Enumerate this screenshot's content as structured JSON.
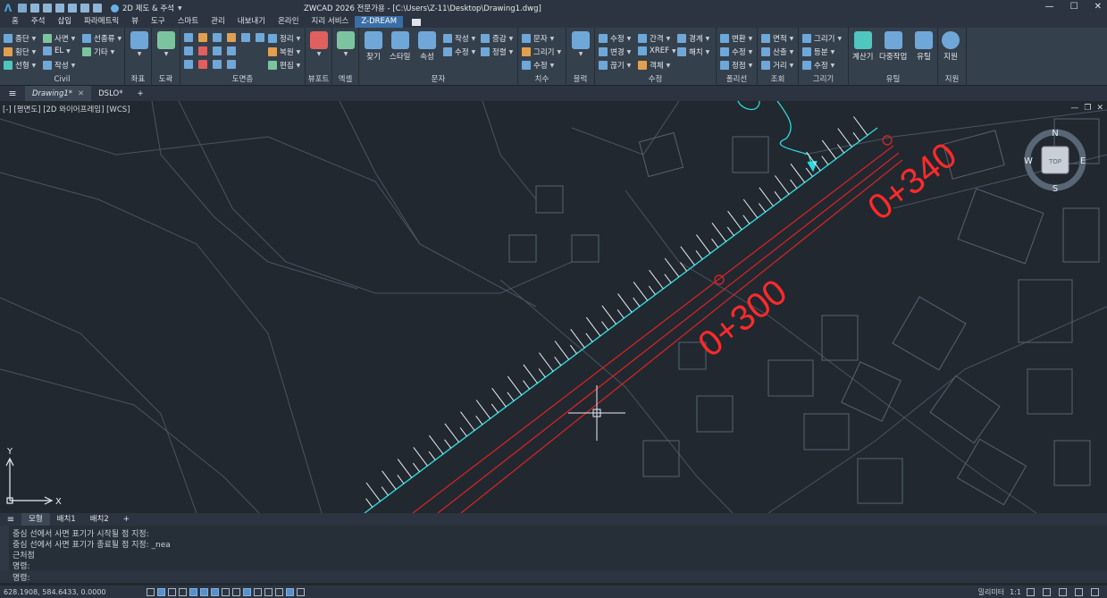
{
  "app": {
    "title": "ZWCAD 2026 전문가용 - [C:\\Users\\Z-11\\Desktop\\Drawing1.dwg]",
    "workspace": "2D 제도 & 주석"
  },
  "menu_tabs": [
    "홈",
    "주석",
    "삽입",
    "파라메트릭",
    "뷰",
    "도구",
    "스마트",
    "관리",
    "내보내기",
    "온라인",
    "지리 서비스",
    "Z-DREAM"
  ],
  "menu_active": "Z-DREAM",
  "ribbon": {
    "civil": {
      "title": "Civil",
      "items": [
        "종단",
        "사면",
        "선종류",
        "횡단",
        "EL",
        "기타",
        "선형",
        "작성"
      ]
    },
    "coord": {
      "title": "좌표"
    },
    "drawing": {
      "title": "도곽"
    },
    "sheet": {
      "title": "도면층",
      "items": [
        "정리",
        "복원",
        "편집"
      ]
    },
    "viewport": {
      "title": "뷰포트"
    },
    "excel": {
      "title": "엑셀"
    },
    "text": {
      "title": "문자",
      "buttons": [
        "찾기",
        "스타일",
        "속성"
      ],
      "items": [
        "작성",
        "증감",
        "수정",
        "정렬"
      ]
    },
    "dim": {
      "title": "치수",
      "items": [
        "문자",
        "그리기",
        "수정"
      ]
    },
    "block": {
      "title": "블럭"
    },
    "modify": {
      "title": "수정",
      "items": [
        "수정",
        "간격",
        "경계",
        "변경",
        "XREF",
        "해치",
        "끊기",
        "객체"
      ]
    },
    "polyline": {
      "title": "폴리선",
      "items": [
        "변환",
        "수정",
        "정점"
      ]
    },
    "query": {
      "title": "조회",
      "items": [
        "면적",
        "산출",
        "거리"
      ]
    },
    "draw": {
      "title": "그리기",
      "items": [
        "그리기",
        "등분",
        "수정"
      ]
    },
    "util": {
      "title": "유틸",
      "buttons": [
        "계산기",
        "다중작업",
        "유틸"
      ]
    },
    "support": {
      "title": "지원",
      "buttons": [
        "지원"
      ]
    }
  },
  "doc_tabs": [
    "Drawing1*",
    "DSLO*"
  ],
  "viewport_label": "[-] [평면도] [2D 와이어프레임] [WCS]",
  "viewcube": {
    "n": "N",
    "s": "S",
    "e": "E",
    "w": "W",
    "top": "TOP"
  },
  "stations": [
    "0+300",
    "0+340"
  ],
  "ucs": {
    "x": "X",
    "y": "Y"
  },
  "layout_tabs": [
    "모형",
    "배치1",
    "배치2"
  ],
  "command_history": [
    "중심 선에서 사면 표기가 시작될 점 지정:",
    "중심 선에서 사면 표기가 종료될 점 지정: _nea",
    "근처점",
    "명령:"
  ],
  "command_prompt": "명령:",
  "coordinates": "628.1908, 584.6433, 0.0000",
  "status_right": {
    "unit": "밀리미터",
    "scale": "1:1"
  },
  "colors": {
    "accent": "#3a6ea5",
    "slope": "#2fd9d9",
    "alignment": "#e02020",
    "background": "#212830"
  }
}
